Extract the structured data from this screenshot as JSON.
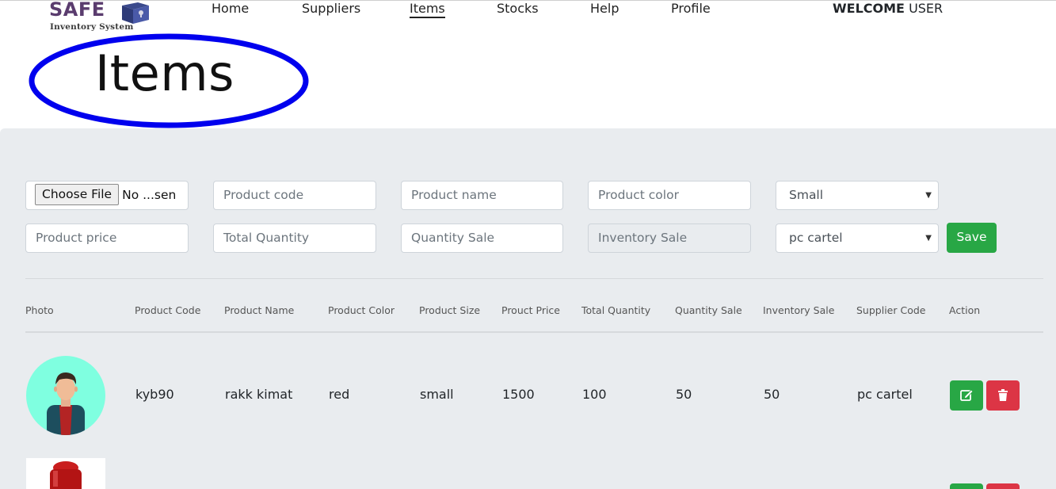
{
  "brand": {
    "name": "SAFE",
    "subtitle": "Inventory System"
  },
  "nav": {
    "items": [
      {
        "label": "Home"
      },
      {
        "label": "Suppliers"
      },
      {
        "label": "Items",
        "active": true
      },
      {
        "label": "Stocks"
      },
      {
        "label": "Help"
      },
      {
        "label": "Profile"
      }
    ],
    "welcome_bold": "WELCOME",
    "welcome_user": "USER"
  },
  "page": {
    "title": "Items",
    "highlight_color": "#0000ee"
  },
  "form": {
    "file_button": "Choose File",
    "file_status": "No ...sen",
    "product_code_placeholder": "Product code",
    "product_name_placeholder": "Product name",
    "product_color_placeholder": "Product color",
    "size_selected": "Small",
    "product_price_placeholder": "Product price",
    "total_quantity_placeholder": "Total Quantity",
    "quantity_sale_placeholder": "Quantity Sale",
    "inventory_sale_placeholder": "Inventory Sale",
    "supplier_selected": "pc cartel",
    "save_label": "Save"
  },
  "table": {
    "headers": [
      "Photo",
      "Product Code",
      "Product Name",
      "Product Color",
      "Product Size",
      "Prouct Price",
      "Total Quantity",
      "Quantity Sale",
      "Inventory Sale",
      "Supplier Code",
      "Action"
    ],
    "rows": [
      {
        "photo": "person-avatar",
        "code": "kyb90",
        "name": "rakk kimat",
        "color": "red",
        "size": "small",
        "price": "1500",
        "total_quantity": "100",
        "quantity_sale": "50",
        "inventory_sale": "50",
        "supplier": "pc cartel"
      },
      {
        "photo": "red-product-image"
      }
    ]
  },
  "colors": {
    "panel_bg": "#e9ecef",
    "success": "#28a745",
    "danger": "#dc3545",
    "avatar_bg": "#7fffe0"
  },
  "icons": {
    "edit": "edit-icon",
    "delete": "trash-icon"
  }
}
